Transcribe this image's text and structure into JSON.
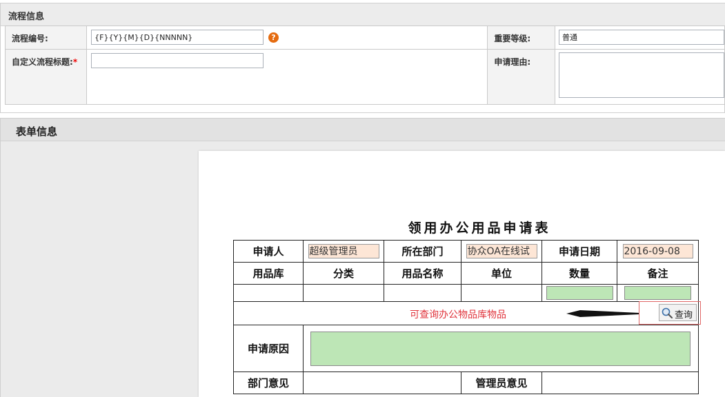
{
  "process_panel": {
    "title": "流程信息",
    "process_no_label": "流程编号:",
    "process_no_value": "{F}{Y}{M}{D}{NNNNN}",
    "help_icon_char": "?",
    "custom_title_label": "自定义流程标题:",
    "required_mark": "*",
    "custom_title_value": "",
    "priority_label": "重要等级:",
    "priority_value": "普通",
    "reason_label": "申请理由:",
    "reason_value": "",
    "help_color": "#e56b10"
  },
  "form_panel": {
    "title": "表单信息"
  },
  "form": {
    "title": "领用办公用品申请表",
    "applicant_label": "申请人",
    "applicant_value": "超级管理员",
    "dept_label": "所在部门",
    "dept_value": "协众OA在线试",
    "date_label": "申请日期",
    "date_value": "2016-09-08",
    "columns": [
      "用品库",
      "分类",
      "用品名称",
      "单位",
      "数量",
      "备注"
    ],
    "hint": "可查询办公物品库物品",
    "query_button": "查询",
    "reason_label": "申请原因",
    "dept_opinion_label": "部门意见",
    "admin_opinion_label": "管理员意见"
  },
  "colors": {
    "input_pink": "#fde6d6",
    "input_green": "#bde6b6",
    "hint_red": "#e0333b"
  }
}
